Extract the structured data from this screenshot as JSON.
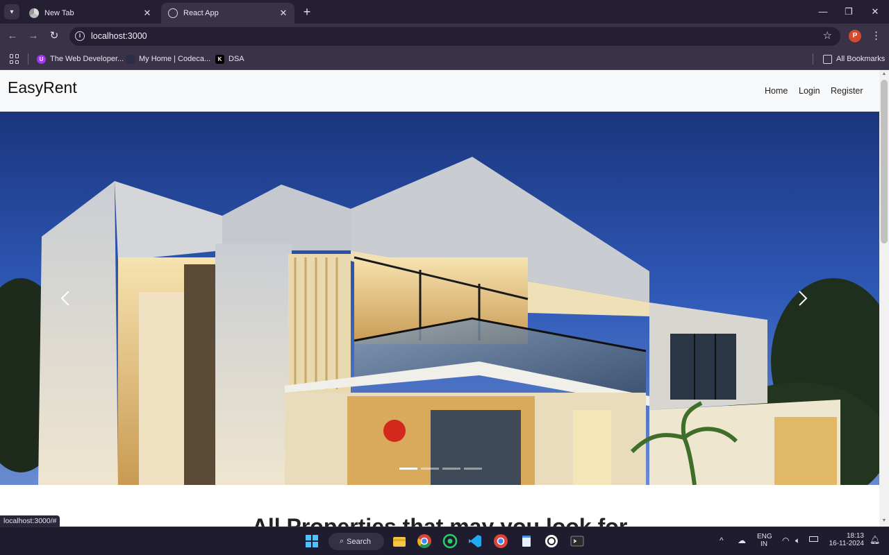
{
  "browser": {
    "tabs": [
      {
        "title": "New Tab",
        "active": false
      },
      {
        "title": "React App",
        "active": true
      }
    ],
    "address": "localhost:3000",
    "profile_initial": "P",
    "bookmarks": [
      {
        "label": "The Web Developer...",
        "icon": "udemy-icon"
      },
      {
        "label": "My Home | Codeca...",
        "icon": "codecademy-icon"
      },
      {
        "label": "DSA",
        "icon": "k-icon"
      }
    ],
    "all_bookmarks": "All Bookmarks",
    "status_url": "localhost:3000/#"
  },
  "page": {
    "brand": "EasyRent",
    "nav": [
      "Home",
      "Login",
      "Register"
    ],
    "carousel": {
      "slides": 4,
      "active_index": 0
    },
    "section_heading": "All Properties that may you look for"
  },
  "taskbar": {
    "search_label": "Search",
    "language": "ENG",
    "region": "IN",
    "time": "18:13",
    "date": "16-11-2024"
  },
  "colors": {
    "tabbar": "#241f33",
    "toolbar": "#3a3348",
    "navbar": "#f8f9fa",
    "taskbar": "#1e1c2e"
  }
}
